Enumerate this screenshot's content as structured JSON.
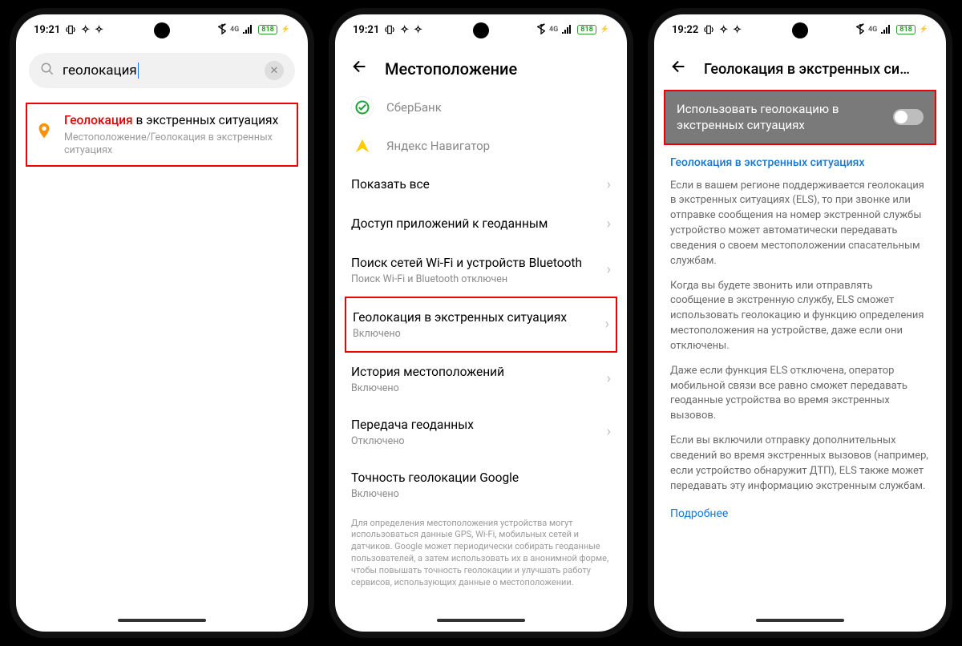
{
  "status": {
    "time_a": "19:21",
    "time_b": "19:22",
    "battery": "818",
    "bt_4g": "4G"
  },
  "s1": {
    "query": "геолокация",
    "result_hl": "Геолокация",
    "result_rest": " в экстренных ситуациях",
    "result_path": "Местоположение/Геолокация в экстренных ситуациях"
  },
  "s2": {
    "title": "Местоположение",
    "app_sber": "СберБанк",
    "app_yandex": "Яндекс Навигатор",
    "show_all": "Показать все",
    "app_access": "Доступ приложений к геоданным",
    "wifi_bt": "Поиск сетей Wi-Fi и устройств Bluetooth",
    "wifi_bt_sub": "Поиск Wi-Fi и Bluetooth отключен",
    "els": "Геолокация в экстренных ситуациях",
    "els_sub": "Включено",
    "history": "История местоположений",
    "history_sub": "Включено",
    "share": "Передача геоданных",
    "share_sub": "Отключено",
    "accuracy": "Точность геолокации Google",
    "accuracy_sub": "Включено",
    "footnote": "Для определения местоположения устройства могут использоваться данные GPS, Wi-Fi, мобильных сетей и датчиков. Google может периодически собирать геоданные пользователей, а затем использовать их в анонимной форме, чтобы повышать точность геолокации и улучшать работу сервисов, использующих данные о местоположении."
  },
  "s3": {
    "title": "Геолокация в экстренных си…",
    "toggle_label": "Использовать геолокацию в экстренных ситуациях",
    "sec_title": "Геолокация в экстренных ситуациях",
    "p1": "Если в вашем регионе поддерживается геолокация в экстренных ситуациях (ELS), то при звонке или отправке сообщения на номер экстренной службы устройство может автоматически передавать сведения о своем местоположении спасательным службам.",
    "p2": "Когда вы будете звонить или отправлять сообщение в экстренную службу, ELS сможет использовать геолокацию и функцию определения местоположения на устройстве, даже если они отключены.",
    "p3": "Даже если функция ELS отключена, оператор мобильной связи все равно сможет передавать геоданные устройства во время экстренных вызовов.",
    "p4": "Если вы включили отправку дополнительных сведений во время экстренных вызовов (например, если устройство обнаружит ДТП), ELS также может передавать эту информацию экстренным службам.",
    "more": "Подробнее"
  }
}
